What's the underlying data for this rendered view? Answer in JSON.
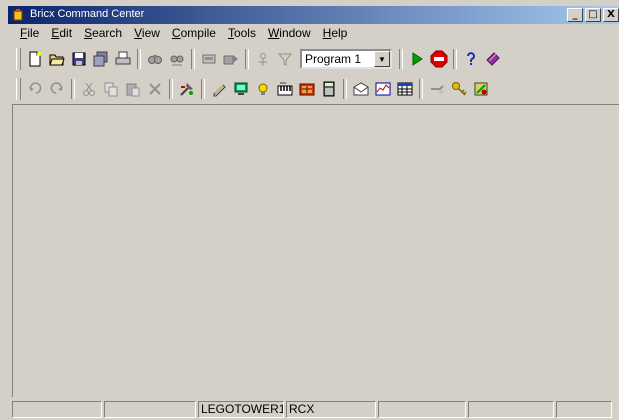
{
  "window": {
    "title": "Bricx Command Center",
    "minimize": "_",
    "maximize": "□",
    "close": "X"
  },
  "menu": [
    {
      "mn": "F",
      "rest": "ile"
    },
    {
      "mn": "E",
      "rest": "dit"
    },
    {
      "mn": "S",
      "rest": "earch"
    },
    {
      "mn": "V",
      "rest": "iew"
    },
    {
      "mn": "C",
      "rest": "ompile"
    },
    {
      "mn": "T",
      "rest": "ools"
    },
    {
      "mn": "W",
      "rest": "indow"
    },
    {
      "mn": "H",
      "rest": "elp"
    }
  ],
  "toolbar": {
    "program_select": "Program 1",
    "program_arrow": "▼"
  },
  "statusbar": {
    "panels": [
      "",
      "",
      "LEGOTOWER1",
      "RCX",
      "",
      "",
      ""
    ]
  }
}
